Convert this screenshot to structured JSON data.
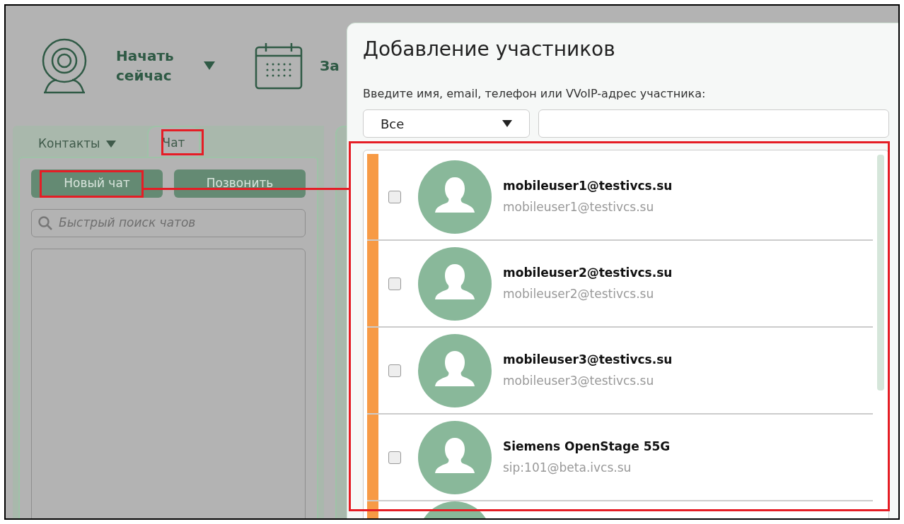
{
  "toolbar": {
    "start_label": "Начать сейчас",
    "schedule_label": "За"
  },
  "sidebar": {
    "tabs": [
      {
        "label": "Контакты",
        "selected": false,
        "dropdown": true
      },
      {
        "label": "Чат",
        "selected": true,
        "dropdown": false
      }
    ],
    "buttons": [
      "Новый чат",
      "Позвонить"
    ],
    "search": {
      "placeholder": "Быстрый поиск чатов"
    }
  },
  "dialog": {
    "title": "Добавление участников",
    "prompt": "Введите имя, email, телефон или VVoIP-адрес участника:",
    "filter": {
      "value": "Все"
    },
    "contacts": [
      {
        "name": "mobileuser1@testivcs.su",
        "address": "mobileuser1@testivcs.su",
        "checked": false
      },
      {
        "name": "mobileuser2@testivcs.su",
        "address": "mobileuser2@testivcs.su",
        "checked": false
      },
      {
        "name": "mobileuser3@testivcs.su",
        "address": "mobileuser3@testivcs.su",
        "checked": false
      },
      {
        "name": "Siemens OpenStage 55G",
        "address": "sip:101@beta.ivcs.su",
        "checked": false
      }
    ],
    "more_below": true
  }
}
